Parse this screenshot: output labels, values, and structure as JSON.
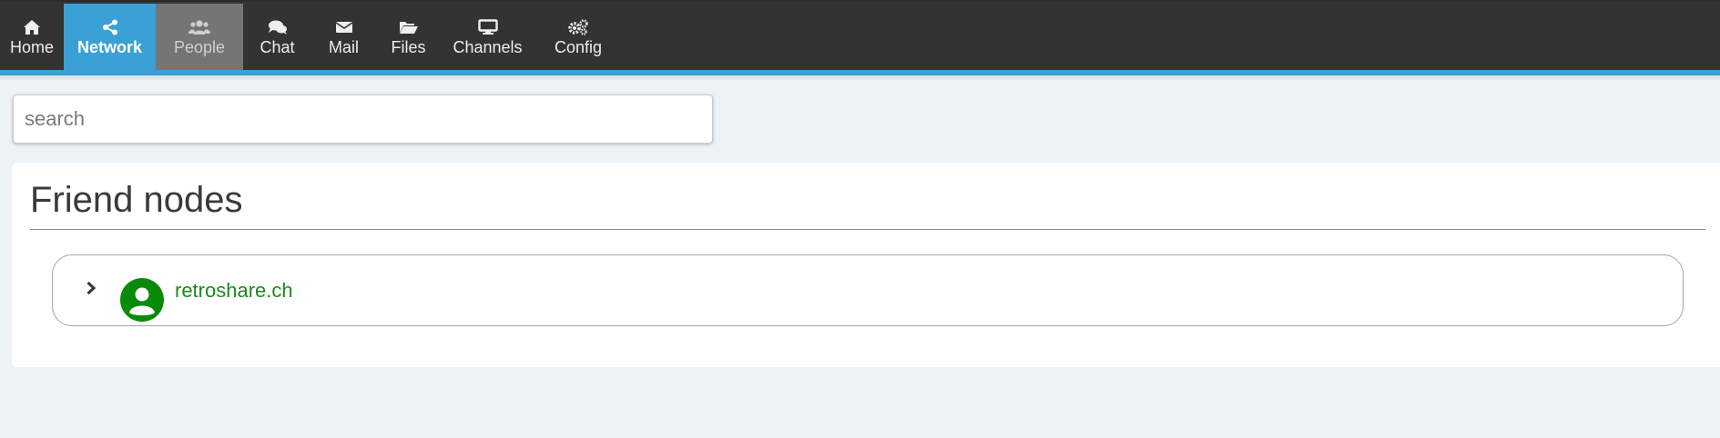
{
  "nav": {
    "items": [
      {
        "label": "Home",
        "icon": "home-icon"
      },
      {
        "label": "Network",
        "icon": "share-icon"
      },
      {
        "label": "People",
        "icon": "people-icon"
      },
      {
        "label": "Chat",
        "icon": "chat-icon"
      },
      {
        "label": "Mail",
        "icon": "mail-icon"
      },
      {
        "label": "Files",
        "icon": "folder-open-icon"
      },
      {
        "label": "Channels",
        "icon": "monitor-icon"
      },
      {
        "label": "Config",
        "icon": "gears-icon"
      }
    ],
    "active": "Network",
    "hovered": "People"
  },
  "search": {
    "placeholder": "search",
    "value": ""
  },
  "friend_nodes": {
    "title": "Friend nodes",
    "nodes": [
      {
        "name": "retroshare.ch",
        "status_color": "#0a8a0a",
        "icon": "user-circle-icon",
        "toggle_icon": "chevron-right-icon"
      }
    ]
  },
  "colors": {
    "topbar": "#333333",
    "accent": "#3aa0d5",
    "hover": "#757575",
    "background": "#edf2f5",
    "online": "#0a8a0a"
  }
}
